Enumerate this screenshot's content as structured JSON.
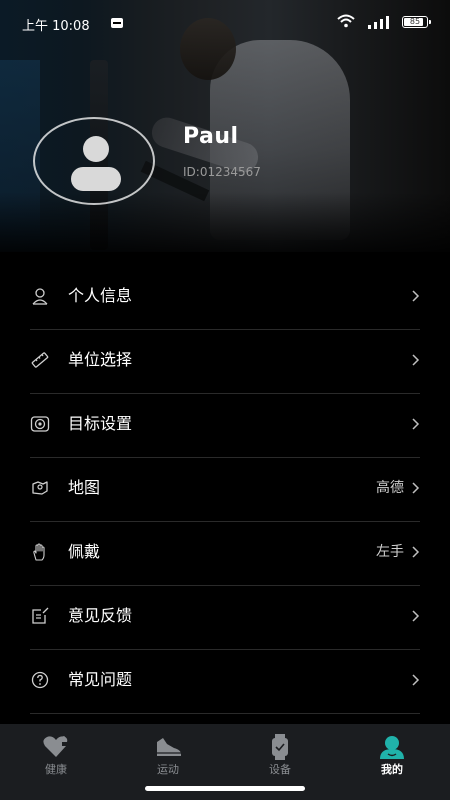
{
  "status_bar": {
    "time": "上午 10:08",
    "battery": "85",
    "battery_level": 0.85
  },
  "profile": {
    "name": "Paul",
    "id": "ID:01234567"
  },
  "menu": [
    {
      "key": "personal-info",
      "label": "个人信息",
      "value": "",
      "icon": "person-icon"
    },
    {
      "key": "unit-select",
      "label": "单位选择",
      "value": "",
      "icon": "ruler-icon"
    },
    {
      "key": "goal-settings",
      "label": "目标设置",
      "value": "",
      "icon": "target-icon"
    },
    {
      "key": "map",
      "label": "地图",
      "value": "高德",
      "icon": "map-icon"
    },
    {
      "key": "wear",
      "label": "佩戴",
      "value": "左手",
      "icon": "hand-icon"
    },
    {
      "key": "feedback",
      "label": "意见反馈",
      "value": "",
      "icon": "edit-icon"
    },
    {
      "key": "faq",
      "label": "常见问题",
      "value": "",
      "icon": "question-icon"
    }
  ],
  "tabs": [
    {
      "label": "健康",
      "icon": "heart-plus-icon",
      "active": false
    },
    {
      "label": "运动",
      "icon": "shoe-icon",
      "active": false
    },
    {
      "label": "设备",
      "icon": "watch-icon",
      "active": false
    },
    {
      "label": "我的",
      "icon": "user-icon",
      "active": true
    }
  ],
  "colors": {
    "accent": "#20b2aa",
    "inactive": "#8a8d91",
    "background": "#000000",
    "tabbar": "#1b1d20"
  }
}
